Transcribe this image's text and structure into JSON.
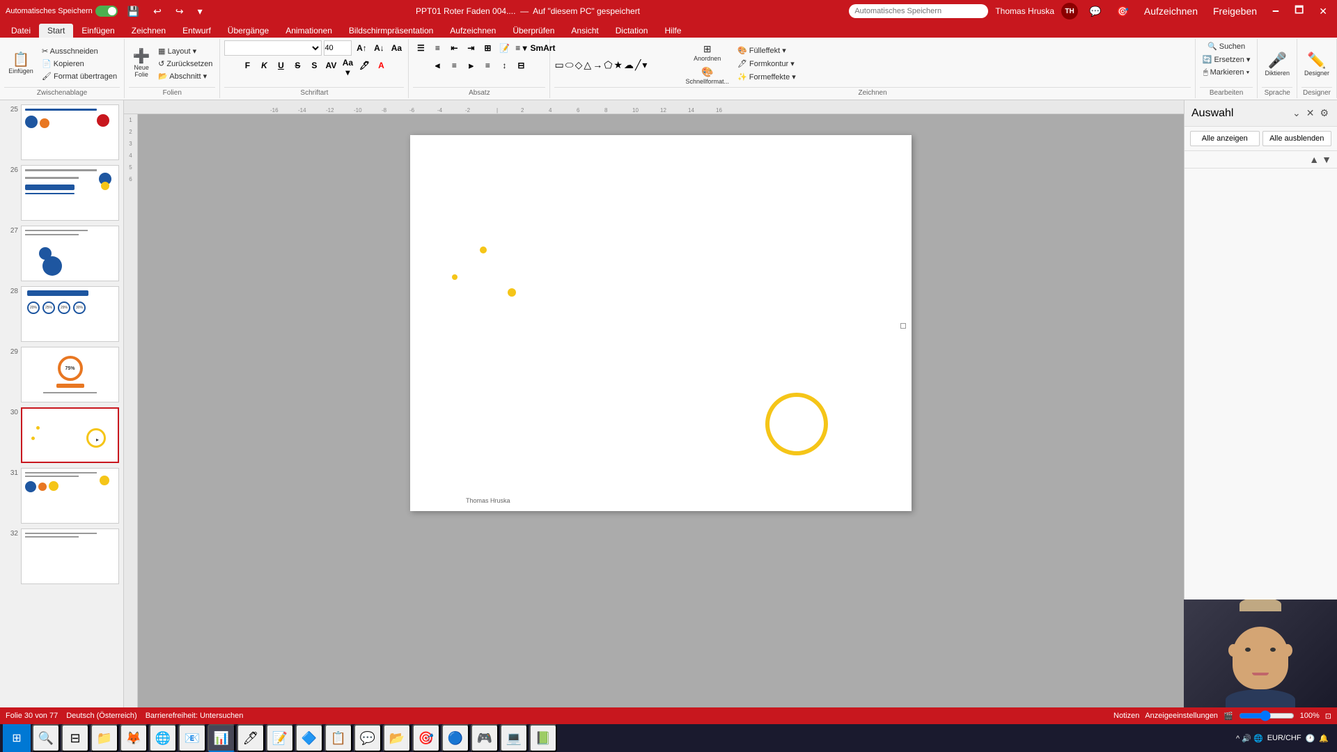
{
  "titleBar": {
    "autosave": "Automatisches Speichern",
    "filename": "PPT01 Roter Faden 004....",
    "saved": "Auf \"diesem PC\" gespeichert",
    "user": "Thomas Hruska",
    "userInitials": "TH",
    "minimize": "🗕",
    "maximize": "🗖",
    "close": "✕"
  },
  "menuBar": {
    "items": [
      "Datei",
      "Start",
      "Einfügen",
      "Zeichnen",
      "Entwurf",
      "Übergänge",
      "Animationen",
      "Bildschirmpräsentation",
      "Aufzeichnen",
      "Überprüfen",
      "Ansicht",
      "Dictation",
      "Hilfe"
    ]
  },
  "ribbon": {
    "groups": [
      {
        "label": "Zwischenablage",
        "buttons": [
          "Einfügen",
          "Ausschneiden",
          "Kopieren",
          "Format übertragen"
        ]
      },
      {
        "label": "Folien",
        "buttons": [
          "Neue Folie",
          "Layout",
          "Zurücksetzen",
          "Abschnitt"
        ]
      },
      {
        "label": "Schriftart",
        "buttons": []
      },
      {
        "label": "Absatz",
        "buttons": []
      },
      {
        "label": "Zeichnen",
        "buttons": []
      },
      {
        "label": "Bearbeiten",
        "buttons": [
          "Suchen",
          "Ersetzen",
          "Markieren"
        ]
      },
      {
        "label": "Sprache",
        "buttons": [
          "Diktieren"
        ]
      },
      {
        "label": "Designer",
        "buttons": [
          "Designer"
        ]
      }
    ],
    "fontName": "",
    "fontSize": "40",
    "boldLabel": "F",
    "italicLabel": "K",
    "underlineLabel": "U",
    "strikeLabel": "S"
  },
  "sidebar": {
    "slides": [
      {
        "number": "25",
        "active": false
      },
      {
        "number": "26",
        "active": false
      },
      {
        "number": "27",
        "active": false
      },
      {
        "number": "28",
        "active": false
      },
      {
        "number": "29",
        "active": false
      },
      {
        "number": "30",
        "active": true
      },
      {
        "number": "31",
        "active": false
      },
      {
        "number": "32",
        "active": false
      }
    ]
  },
  "canvas": {
    "authorText": "Thomas Hruska"
  },
  "rightPanel": {
    "title": "Auswahl",
    "showAll": "Alle anzeigen",
    "hideAll": "Alle ausblenden"
  },
  "statusBar": {
    "slideInfo": "Folie 30 von 77",
    "language": "Deutsch (Österreich)",
    "accessibility": "Barrierefreiheit: Untersuchen",
    "notes": "Notizen",
    "displaySettings": "Anzeigeeinstellungen"
  },
  "taskbar": {
    "startIcon": "⊞",
    "apps": [
      "🗂",
      "📁",
      "🦊",
      "🌐",
      "📧",
      "📊",
      "🖊",
      "📝",
      "🔷",
      "📋",
      "🗒",
      "💬",
      "📂",
      "🎯",
      "🔵",
      "🎮",
      "💻",
      "🟡"
    ],
    "sysInfo": "EUR/CHF"
  }
}
